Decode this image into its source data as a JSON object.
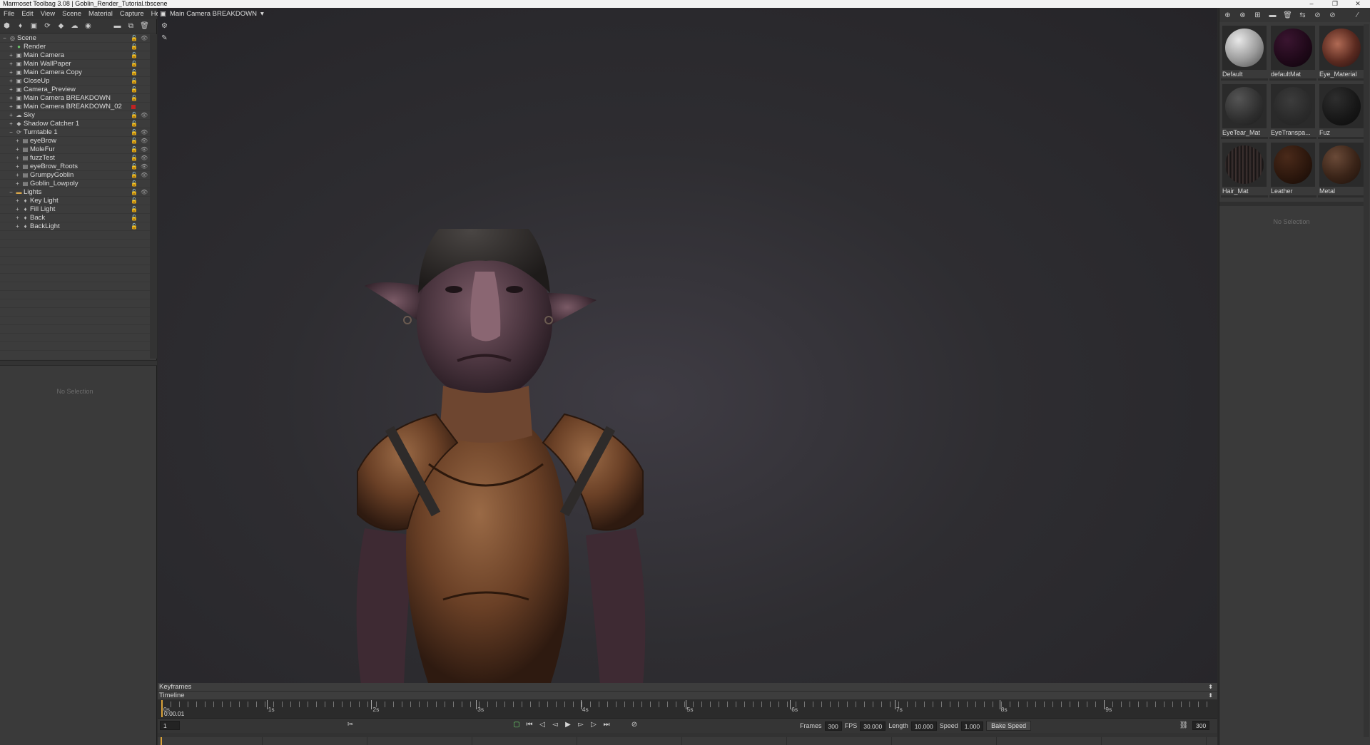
{
  "window": {
    "title": "Marmoset Toolbag 3.08  |  Goblin_Render_Tutorial.tbscene",
    "controls": [
      "–",
      "❐",
      "✕"
    ]
  },
  "menu": [
    "File",
    "Edit",
    "View",
    "Scene",
    "Material",
    "Capture",
    "Help"
  ],
  "scene_tree": [
    {
      "label": "Scene",
      "indent": 0,
      "icon": "scene-icon",
      "glyph": "◎",
      "eye": true
    },
    {
      "label": "Render",
      "indent": 1,
      "icon": "render-icon",
      "glyph": "●",
      "color": "#6ac86a"
    },
    {
      "label": "Main Camera",
      "indent": 1,
      "icon": "camera-icon",
      "glyph": "▣"
    },
    {
      "label": "Main WallPaper",
      "indent": 1,
      "icon": "camera-icon",
      "glyph": "▣"
    },
    {
      "label": "Main Camera Copy",
      "indent": 1,
      "icon": "camera-icon",
      "glyph": "▣"
    },
    {
      "label": "CloseUp",
      "indent": 1,
      "icon": "camera-icon",
      "glyph": "▣"
    },
    {
      "label": "Camera_Preview",
      "indent": 1,
      "icon": "camera-icon",
      "glyph": "▣"
    },
    {
      "label": "Main Camera BREAKDOWN",
      "indent": 1,
      "icon": "camera-icon",
      "glyph": "▣"
    },
    {
      "label": "Main Camera BREAKDOWN_02",
      "indent": 1,
      "icon": "camera-icon",
      "glyph": "▣",
      "red": true
    },
    {
      "label": "Sky",
      "indent": 1,
      "icon": "sky-icon",
      "glyph": "☁",
      "eye": true
    },
    {
      "label": "Shadow Catcher 1",
      "indent": 1,
      "icon": "shadow-catcher-icon",
      "glyph": "◆"
    },
    {
      "label": "Turntable 1",
      "indent": 1,
      "icon": "turntable-icon",
      "glyph": "⟳",
      "eye": true
    },
    {
      "label": "eyeBrow",
      "indent": 2,
      "icon": "mesh-icon",
      "glyph": "▤",
      "eye": true
    },
    {
      "label": "MoleFur",
      "indent": 2,
      "icon": "mesh-icon",
      "glyph": "▤",
      "eye": true
    },
    {
      "label": "fuzzTest",
      "indent": 2,
      "icon": "mesh-icon",
      "glyph": "▤",
      "eye": true
    },
    {
      "label": "eyeBrow_Roots",
      "indent": 2,
      "icon": "mesh-icon",
      "glyph": "▤",
      "eye": true
    },
    {
      "label": "GrumpyGoblin",
      "indent": 2,
      "icon": "mesh-icon",
      "glyph": "▤",
      "eye": true
    },
    {
      "label": "Goblin_Lowpoly",
      "indent": 2,
      "icon": "mesh-icon",
      "glyph": "▤"
    },
    {
      "label": "Lights",
      "indent": 1,
      "icon": "folder-icon",
      "glyph": "▬",
      "color": "#d8a64a",
      "eye": true
    },
    {
      "label": "Key Light",
      "indent": 2,
      "icon": "light-icon",
      "glyph": "♦"
    },
    {
      "label": "Fill Light",
      "indent": 2,
      "icon": "light-icon",
      "glyph": "♦"
    },
    {
      "label": "Back",
      "indent": 2,
      "icon": "light-icon",
      "glyph": "♦"
    },
    {
      "label": "BackLight",
      "indent": 2,
      "icon": "light-icon",
      "glyph": "♦"
    }
  ],
  "left_props": {
    "empty": "No Selection"
  },
  "viewport": {
    "camera": "Main Camera BREAKDOWN"
  },
  "materials": [
    {
      "name": "Default",
      "grad": "radial-gradient(circle at 35% 30%, #e8e8e8, #9a9a9a 55%, #4a4a4a)"
    },
    {
      "name": "defaultMat",
      "grad": "radial-gradient(circle at 35% 30%, #3a1530, #1e0818 60%, #0d040b)"
    },
    {
      "name": "Eye_Material",
      "grad": "radial-gradient(circle at 40% 40%, #b06a54, #5a2a20 55%, #231010)"
    },
    {
      "name": "EyeTear_Mat",
      "grad": "radial-gradient(circle at 35% 30%, #555, #2e2e2e 60%, #1c1c1c)"
    },
    {
      "name": "EyeTranspa...",
      "grad": "radial-gradient(circle at 45% 35%, #3c3c3c, #2a2a2a 60%, #222)"
    },
    {
      "name": "Fuz",
      "grad": "radial-gradient(circle at 35% 30%, #2e2e2e, #161616 60%, #0b0b0b)"
    },
    {
      "name": "Hair_Mat",
      "grad": "repeating-linear-gradient(90deg, #3a3030 0, #121010 3px, #4a3a38 5px), radial-gradient(circle, #333, #111)"
    },
    {
      "name": "Leather",
      "grad": "radial-gradient(circle at 35% 30%, #4a2a1a, #2a160c 60%, #140a06)"
    },
    {
      "name": "Metal",
      "grad": "radial-gradient(circle at 35% 30%, #6a4a38, #3a2418 55%, #1c100a)"
    }
  ],
  "right_props": {
    "empty": "No Selection"
  },
  "bottom": {
    "keyframes_label": "Keyframes",
    "timeline_label": "Timeline",
    "ruler_seconds": [
      "0s",
      "1s",
      "2s",
      "3s",
      "4s",
      "5s",
      "6s",
      "7s",
      "8s",
      "9s"
    ],
    "timecode": "0:00.01",
    "frame_field": "1",
    "frames_label": "Frames",
    "frames_value": "300",
    "fps_label": "FPS",
    "fps_value": "30.000",
    "length_label": "Length",
    "length_value": "10.000",
    "speed_label": "Speed",
    "speed_value": "1.000",
    "bake_speed": "Bake Speed",
    "end_frame": "300"
  }
}
